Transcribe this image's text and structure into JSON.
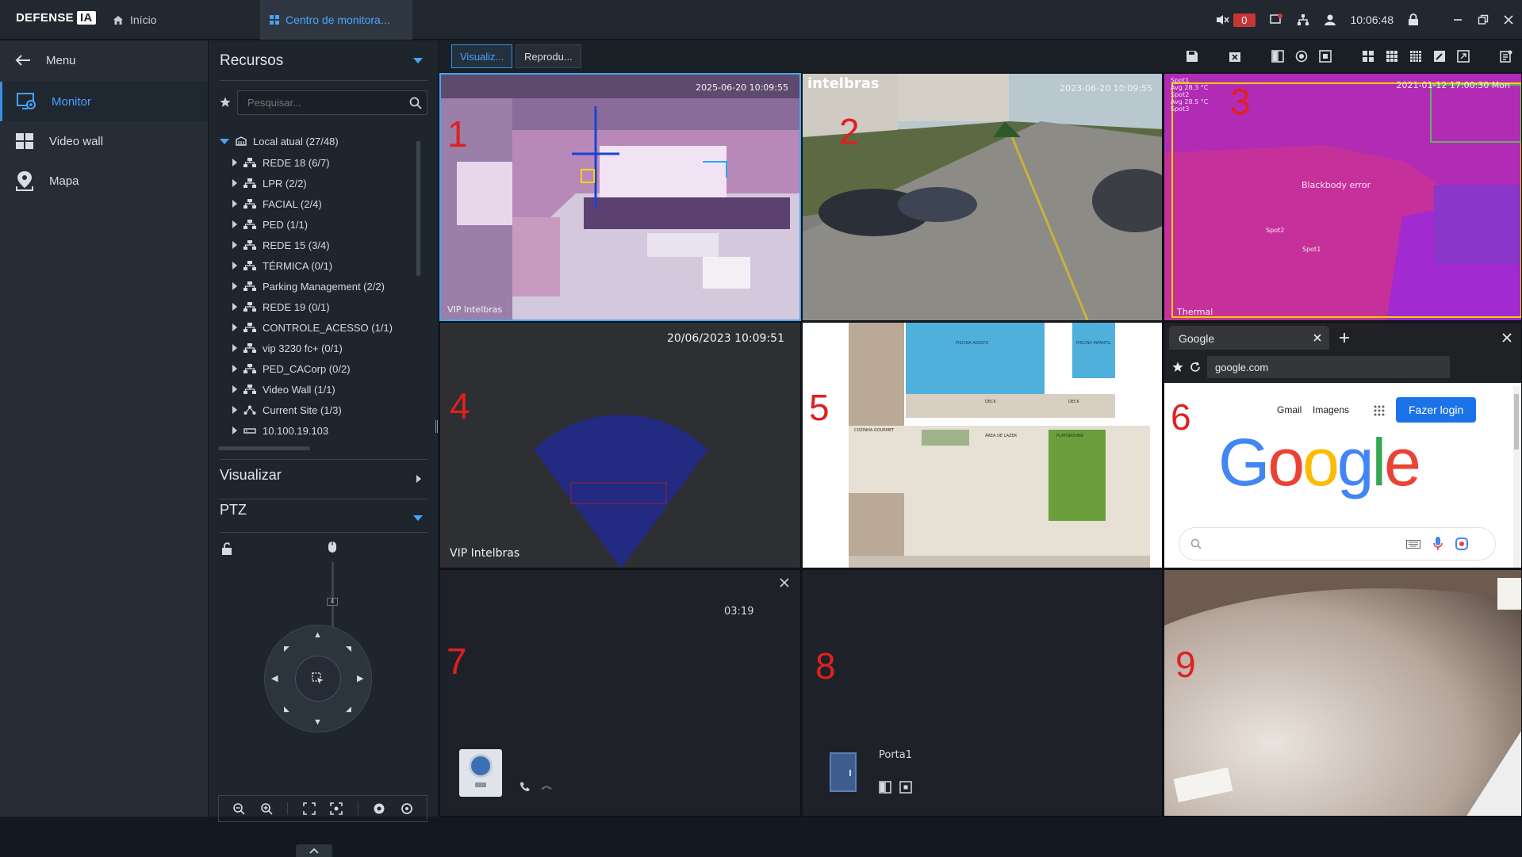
{
  "app": {
    "logo": "DEFENSE",
    "logo_badge": "IA"
  },
  "tabs": [
    {
      "label": "Início"
    },
    {
      "label": "Centro de monitora..."
    }
  ],
  "topbar": {
    "alarm_count": "0",
    "time": "10:06:48"
  },
  "nav": {
    "menu_label": "Menu",
    "items": [
      {
        "label": "Monitor",
        "icon": "monitor-icon",
        "active": true
      },
      {
        "label": "Video wall",
        "icon": "video-wall-icon"
      },
      {
        "label": "Mapa",
        "icon": "map-pin-icon"
      }
    ]
  },
  "resources": {
    "title": "Recursos",
    "search_placeholder": "Pesquisar...",
    "root": "Local atual (27/48)",
    "items": [
      {
        "label": "REDE 18 (6/7)",
        "icon": "network-icon"
      },
      {
        "label": "LPR (2/2)",
        "icon": "network-icon"
      },
      {
        "label": "FACIAL (2/4)",
        "icon": "network-icon"
      },
      {
        "label": "PED (1/1)",
        "icon": "network-icon"
      },
      {
        "label": "REDE 15 (3/4)",
        "icon": "network-icon"
      },
      {
        "label": "TÉRMICA (0/1)",
        "icon": "network-icon"
      },
      {
        "label": "Parking Management (2/2)",
        "icon": "network-icon"
      },
      {
        "label": "REDE 19 (0/1)",
        "icon": "network-icon"
      },
      {
        "label": "CONTROLE_ACESSO (1/1)",
        "icon": "network-icon"
      },
      {
        "label": "vip 3230 fc+ (0/1)",
        "icon": "network-icon"
      },
      {
        "label": "PED_CACorp (0/2)",
        "icon": "network-icon"
      },
      {
        "label": "Video Wall (1/1)",
        "icon": "network-icon"
      },
      {
        "label": "Current Site (1/3)",
        "icon": "site-icon"
      },
      {
        "label": "10.100.19.103",
        "icon": "device-icon"
      }
    ]
  },
  "sections": {
    "visualizar": "Visualizar",
    "ptz": "PTZ",
    "ptz_zoom_level": "4"
  },
  "view_tabs": [
    {
      "label": "Visualiz..."
    },
    {
      "label": "Reprodu..."
    }
  ],
  "tiles": [
    {
      "number": "1",
      "timestamp": "2025-06-20 10:09:55",
      "caption": "VIP Intelbras"
    },
    {
      "number": "2",
      "timestamp": "2023-06-20 10:09:55",
      "brand": "intelbras"
    },
    {
      "number": "3",
      "timestamp": "2021-01-12 17:00:30 Mon",
      "overlay_lines": [
        "Spot1",
        "Avg 28.3 °C",
        "Spot2",
        "Avg 28.5 °C",
        "Spot3"
      ],
      "center_text": "Blackbody error",
      "labels": [
        "Spot2",
        "Spot1"
      ],
      "caption": "Thermal"
    },
    {
      "number": "4",
      "timestamp": "20/06/2023 10:09:51",
      "caption": "VIP Intelbras"
    },
    {
      "number": "5",
      "plan_labels": [
        "PISCINA ADULTO",
        "PISCINA INFANTIL",
        "DECK",
        "DECK",
        "COZINHA GOURMET",
        "ÁREA DE LAZER",
        "PLAYGROUND"
      ]
    },
    {
      "number": "6",
      "browser": {
        "tab": "Google",
        "url": "google.com",
        "links": [
          "Gmail",
          "Imagens"
        ],
        "login": "Fazer login",
        "logo": [
          "G",
          "o",
          "o",
          "g",
          "l",
          "e"
        ]
      }
    },
    {
      "number": "7",
      "call_time": "03:19"
    },
    {
      "number": "8",
      "door_label": "Porta1"
    },
    {
      "number": "9"
    }
  ]
}
